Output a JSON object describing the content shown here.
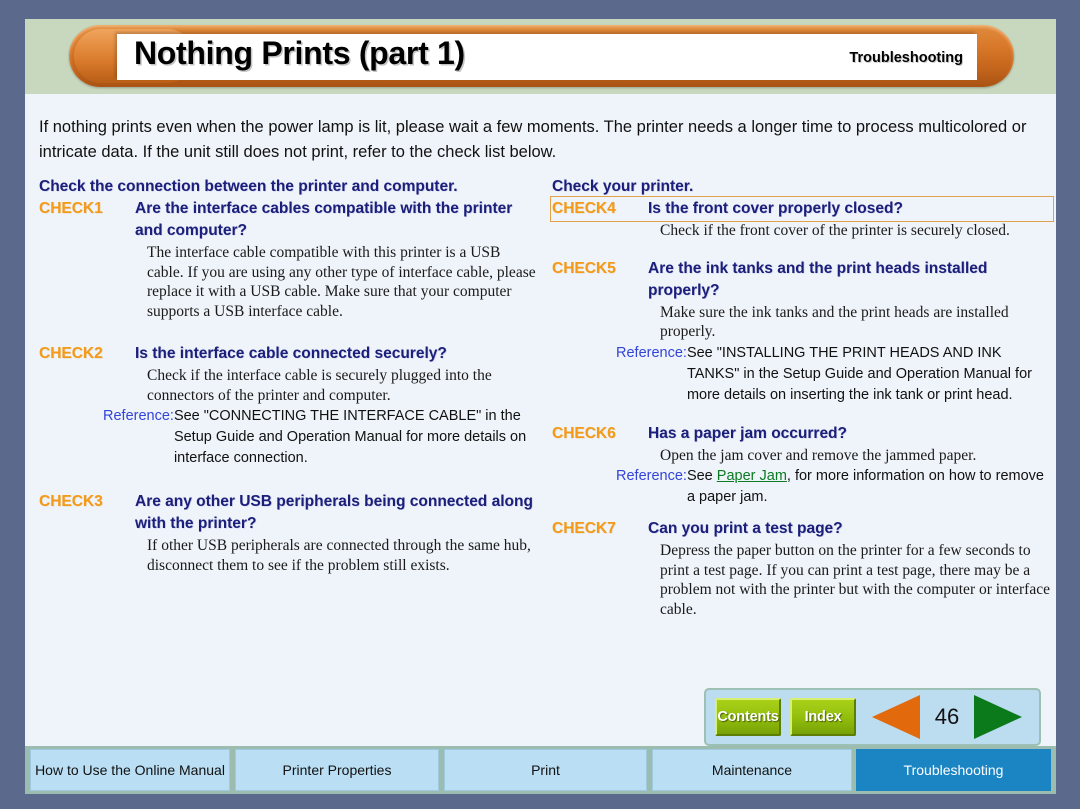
{
  "header": {
    "title": "Nothing Prints (part 1)",
    "section": "Troubleshooting"
  },
  "intro": "If nothing prints even when the power lamp is lit, please wait a few moments. The printer needs a longer time to process multicolored or intricate data. If the unit still does not print, refer to the check list below.",
  "left_column": {
    "section_heading": "Check the connection between the printer and computer.",
    "checks": [
      {
        "tag": "CHECK1",
        "question": "Are the interface cables compatible with the printer and computer?",
        "body": "The interface cable compatible with this printer is a USB cable. If you are using any other type of interface cable, please replace it with a USB cable. Make sure that your computer supports a USB interface cable."
      },
      {
        "tag": "CHECK2",
        "question": "Is the interface cable connected securely?",
        "body": "Check if the interface cable is securely plugged into the connectors of the printer and computer.",
        "reference_label": "Reference:",
        "reference_text": "See \"CONNECTING THE INTERFACE CABLE\" in the Setup Guide and Operation Manual for more details on interface connection."
      },
      {
        "tag": "CHECK3",
        "question": "Are any other USB peripherals being connected along with the printer?",
        "body": "If other USB peripherals are connected through the same hub, disconnect them to see if the problem still exists."
      }
    ]
  },
  "right_column": {
    "section_heading": "Check your printer.",
    "checks": [
      {
        "tag": "CHECK4",
        "question": "Is the front cover properly closed?",
        "body": "Check if the front cover of the printer is securely closed."
      },
      {
        "tag": "CHECK5",
        "question": "Are the ink tanks and the print heads installed properly?",
        "body": "Make sure the ink tanks and the print heads are installed properly.",
        "reference_label": "Reference:",
        "reference_text": "See \"INSTALLING THE PRINT HEADS AND INK TANKS\" in the Setup Guide and Operation Manual for more details on inserting the ink tank or print head."
      },
      {
        "tag": "CHECK6",
        "question": "Has a paper jam occurred?",
        "body": "Open the jam cover and remove the jammed paper.",
        "reference_label": "Reference:",
        "reference_prefix": "See ",
        "reference_link": "Paper Jam",
        "reference_suffix": ", for more information on how to remove a paper jam."
      },
      {
        "tag": "CHECK7",
        "question": "Can you print a test page?",
        "body": "Depress the paper button on the printer for a few seconds to print a test page. If you can print a test page, there may be a problem not with the printer but with the computer or interface cable."
      }
    ]
  },
  "nav": {
    "contents_label": "Contents",
    "index_label": "Index",
    "page_number": "46",
    "prev_icon": "left-triangle-icon",
    "next_icon": "right-triangle-icon",
    "prev_color": "#e2690c",
    "next_color": "#0a7a1a"
  },
  "tabs": [
    {
      "label": "How to Use the Online Manual",
      "active": false
    },
    {
      "label": "Printer Properties",
      "active": false
    },
    {
      "label": "Print",
      "active": false
    },
    {
      "label": "Maintenance",
      "active": false
    },
    {
      "label": "Troubleshooting",
      "active": true
    }
  ],
  "colors": {
    "frame": "#5b6a8c",
    "header_band": "#c7d8bf",
    "sheet": "#eff4fa",
    "title_orange": "#d9782a",
    "heading_navy": "#1b1f7a",
    "check_orange": "#f49a16",
    "reference_blue": "#3344d8",
    "link_green": "#0c7a23",
    "tab_blue": "#badff4",
    "tab_active_blue": "#1b85c4"
  }
}
